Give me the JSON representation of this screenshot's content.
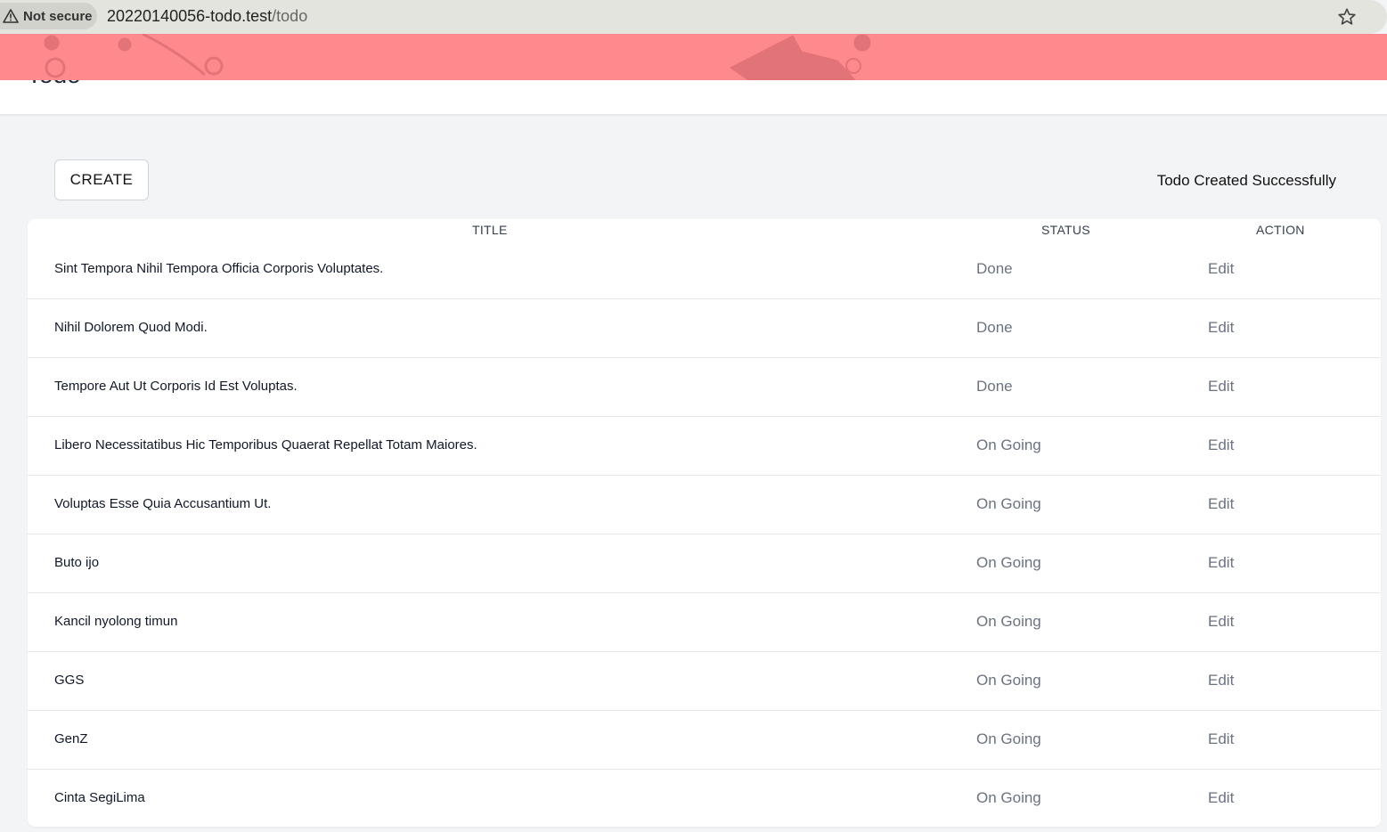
{
  "browser": {
    "security_label": "Not secure",
    "url_host": "20220140056-todo.test",
    "url_path": "/todo"
  },
  "header": {
    "title": "Todo"
  },
  "toolbar": {
    "create_label": "CREATE",
    "flash_message": "Todo Created Successfully"
  },
  "table": {
    "columns": [
      "TITLE",
      "STATUS",
      "ACTION"
    ],
    "rows": [
      {
        "title": "Sint Tempora Nihil Tempora Officia Corporis Voluptates.",
        "status": "Done",
        "action": "Edit"
      },
      {
        "title": "Nihil Dolorem Quod Modi.",
        "status": "Done",
        "action": "Edit"
      },
      {
        "title": "Tempore Aut Ut Corporis Id Est Voluptas.",
        "status": "Done",
        "action": "Edit"
      },
      {
        "title": "Libero Necessitatibus Hic Temporibus Quaerat Repellat Totam Maiores.",
        "status": "On Going",
        "action": "Edit"
      },
      {
        "title": "Voluptas Esse Quia Accusantium Ut.",
        "status": "On Going",
        "action": "Edit"
      },
      {
        "title": "Buto ijo",
        "status": "On Going",
        "action": "Edit"
      },
      {
        "title": "Kancil nyolong timun",
        "status": "On Going",
        "action": "Edit"
      },
      {
        "title": "GGS",
        "status": "On Going",
        "action": "Edit"
      },
      {
        "title": "GenZ",
        "status": "On Going",
        "action": "Edit"
      },
      {
        "title": "Cinta SegiLima",
        "status": "On Going",
        "action": "Edit"
      }
    ]
  },
  "icons": {
    "security": "warning-triangle-icon",
    "bookmark": "star-icon"
  },
  "colors": {
    "banner": "#ff8a8e",
    "page_background": "#f3f4f6",
    "addressbar": "#e4e4df"
  }
}
